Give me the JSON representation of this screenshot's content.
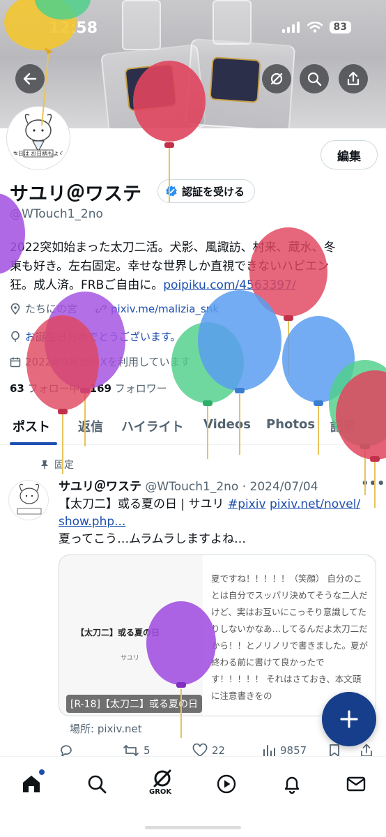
{
  "status_bar": {
    "time": "12:58",
    "battery": "83"
  },
  "header": {
    "back_icon": "arrow-left-icon",
    "actions": [
      "grok-icon",
      "search-icon",
      "share-icon"
    ]
  },
  "profile": {
    "avatar_caption": "本日は お日柄もよく",
    "edit_label": "編集",
    "display_name": "サユリ＠ワステ",
    "verify_label": "認証を受ける",
    "handle": "@WTouch1_2no",
    "bio_line1": "2022突如始まった太刀二活。犬影、風諏訪、村来、蔵水、冬",
    "bio_line2": "東も好き。左右固定。幸せな世界しか直視できないハピエン",
    "bio_line3_text": "狂。成人済。FRBご自由に。",
    "bio_link": "poipiku.com/4563397/",
    "location": "たちにの宮",
    "website": "pixiv.me/malizia_snk",
    "birthday": "お誕生日おめでとうございます。",
    "joined": "2022年9月からXを利用しています",
    "following_count": "63",
    "following_label": "フォロー中",
    "followers_count": "169",
    "followers_label": "フォロワー"
  },
  "tabs": [
    "ポスト",
    "返信",
    "ハイライト",
    "Videos",
    "Photos",
    "記事"
  ],
  "post": {
    "pinned_label": "固定",
    "author_name": "サユリ＠ワステ",
    "author_handle": "@WTouch1_2no",
    "date": "2024/07/04",
    "text_part1": "【太刀二】或る夏の日 | サユリ ",
    "hashtag": "#pixiv",
    "link1": "pixiv.net/novel/",
    "link2": "show.php...",
    "text_line3": "夏ってこう…ムラムラしますよね…",
    "card_title": "【太刀二】或る夏の日",
    "card_author": "サユリ",
    "card_text": "夏ですね！！！！！（笑顔） 自分のことは自分でスッパリ決めてそうな二人だけど、実はお互いにこっそり意識してたりしないかなあ…してるんだよ太刀二だから！！とノリノリで書きました。夏が終わる前に書けて良かったです！！！！！ それはさておき、本文頭に注意書きをの",
    "card_caption": "[R-18]【太刀二】或る夏の日",
    "place": "場所: pixiv.net",
    "retweets": "5",
    "likes": "22",
    "views": "9857"
  },
  "bottom_nav": {
    "items": [
      "home-icon",
      "search-icon",
      "grok-icon",
      "video-icon",
      "bell-icon",
      "mail-icon"
    ],
    "grok_label": "GROK"
  },
  "colors": {
    "accent": "#1d4fb0",
    "fab": "#173e8a",
    "balloon_red": "#e0455e",
    "balloon_blue": "#5a9ef0",
    "balloon_green": "#4fd08a",
    "balloon_purple": "#a24fe0",
    "balloon_yellow": "#f2c531"
  }
}
